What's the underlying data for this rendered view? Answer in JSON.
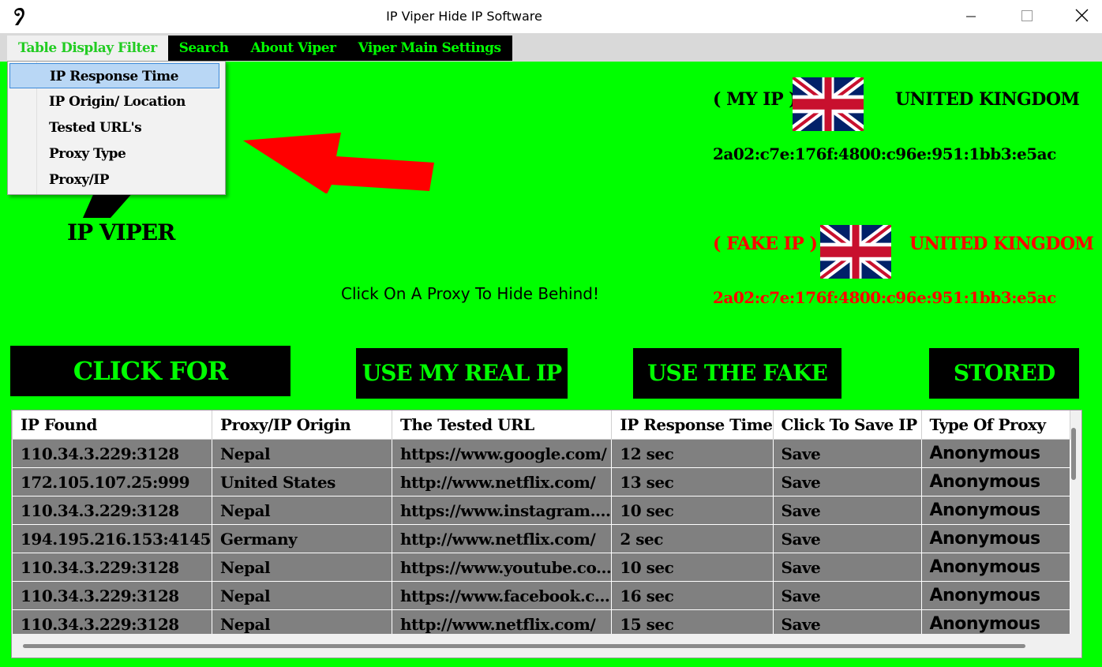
{
  "window": {
    "title": "IP Viper Hide IP Software"
  },
  "menu": {
    "items": [
      "Table Display Filter",
      "Search",
      "About Viper",
      "Viper Main Settings"
    ],
    "dropdown": [
      "IP Response Time",
      "IP Origin/ Location",
      "Tested URL's",
      "Proxy Type",
      "Proxy/IP"
    ]
  },
  "logo": {
    "text": "IP VIPER"
  },
  "my_ip": {
    "label": "( MY IP )",
    "country": "UNITED KINGDOM",
    "address": "2a02:c7e:176f:4800:c96e:951:1bb3:e5ac"
  },
  "fake_ip": {
    "label": "( FAKE  IP )",
    "country": "UNITED KINGDOM",
    "address": "2a02:c7e:176f:4800:c96e:951:1bb3:e5ac"
  },
  "hint": "Click On A Proxy To Hide Behind!",
  "buttons": {
    "proxies": "CLICK FOR PROXIES",
    "real_ip": "USE MY REAL IP",
    "fake_ip": "USE THE FAKE IP",
    "stored": "STORED IP'S"
  },
  "table": {
    "headers": [
      "IP Found",
      "Proxy/IP Origin",
      "The Tested URL",
      "IP Response Time",
      "Click To Save IP",
      "Type Of Proxy"
    ],
    "rows": [
      [
        "110.34.3.229:3128",
        "Nepal",
        "https://www.google.com/",
        "12 sec",
        "Save",
        "Anonymous"
      ],
      [
        "172.105.107.25:999",
        "United States",
        "http://www.netflix.com/",
        "13 sec",
        "Save",
        "Anonymous"
      ],
      [
        "110.34.3.229:3128",
        "Nepal",
        "https://www.instagram....",
        "10 sec",
        "Save",
        "Anonymous"
      ],
      [
        "194.195.216.153:4145",
        "Germany",
        "http://www.netflix.com/",
        "2 sec",
        "Save",
        "Anonymous"
      ],
      [
        "110.34.3.229:3128",
        "Nepal",
        "https://www.youtube.co...",
        "10 sec",
        "Save",
        "Anonymous"
      ],
      [
        "110.34.3.229:3128",
        "Nepal",
        "https://www.facebook.c...",
        "16 sec",
        "Save",
        "Anonymous"
      ],
      [
        "110.34.3.229:3128",
        "Nepal",
        "http://www.netflix.com/",
        "15 sec",
        "Save",
        "Anonymous"
      ]
    ]
  },
  "colors": {
    "background": "#00ff00",
    "accent_text": "#00ff00",
    "fake_ip_text": "#ff0000",
    "row_bg": "#808080"
  }
}
